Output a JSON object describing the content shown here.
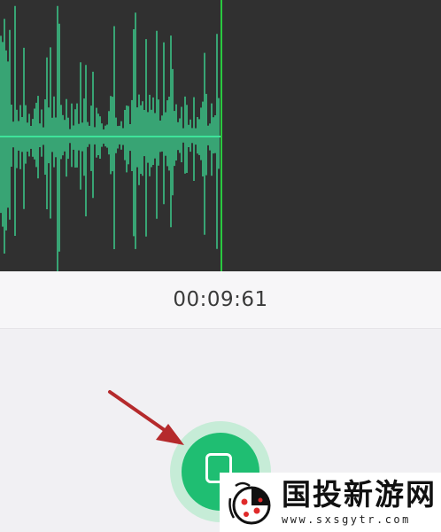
{
  "recorder": {
    "elapsed_time": "00:09:61",
    "waveform_color": "#3ee39a",
    "playhead_color": "#29c93f",
    "panel_color": "#303030"
  },
  "controls": {
    "stop_button_color": "#1fbe72",
    "stop_button_icon": "stop-square-icon"
  },
  "annotation": {
    "arrow_color": "#b52a2c",
    "arrow_icon": "arrow-icon"
  },
  "watermark": {
    "title": "国投新游网",
    "url": "www.sxsgytr.com"
  }
}
